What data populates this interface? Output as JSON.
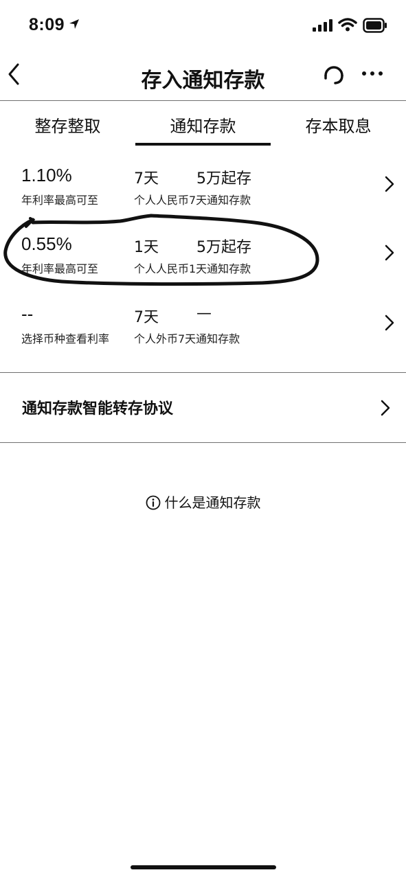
{
  "status_bar": {
    "time": "8:09"
  },
  "nav": {
    "title": "存入通知存款",
    "icons": [
      "back-icon",
      "customer-service-icon",
      "more-icon"
    ]
  },
  "tabs": [
    {
      "label": "整存整取",
      "selected": false
    },
    {
      "label": "通知存款",
      "selected": true
    },
    {
      "label": "存本取息",
      "selected": false
    }
  ],
  "products": [
    {
      "rate": "1.10%",
      "rate_label": "年利率最高可至",
      "term": "7天",
      "minimum": "5万起存",
      "name": "个人人民币7天通知存款"
    },
    {
      "rate": "0.55%",
      "rate_label": "年利率最高可至",
      "term": "1天",
      "minimum": "5万起存",
      "name": "个人人民币1天通知存款"
    },
    {
      "rate": "--",
      "rate_label": "选择币种查看利率",
      "term": "7天",
      "minimum": "—",
      "name": "个人外币7天通知存款"
    }
  ],
  "agreement": {
    "label": "通知存款智能转存协议"
  },
  "info": {
    "label": "什么是通知存款"
  },
  "colors": {
    "text": "#111111",
    "divider": "#6f6f6f",
    "background": "#ffffff"
  }
}
